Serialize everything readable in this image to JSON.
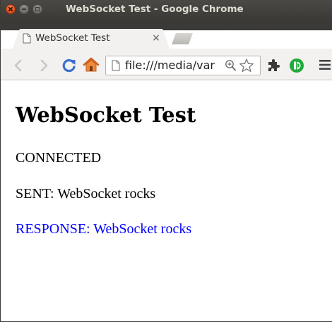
{
  "window": {
    "title": "WebSocket Test - Google Chrome"
  },
  "tab": {
    "title": "WebSocket Test",
    "close_glyph": "×"
  },
  "omnibox": {
    "url": "file:///media/var"
  },
  "page": {
    "heading": "WebSocket Test",
    "messages": [
      {
        "text": "CONNECTED",
        "color": "#000000"
      },
      {
        "text": "SENT: WebSocket rocks",
        "color": "#000000"
      },
      {
        "text": "RESPONSE: WebSocket rocks",
        "color": "#0000ff"
      }
    ]
  },
  "colors": {
    "titlebar": "#3c3b37",
    "close_button": "#e95420",
    "toolbar": "#f2f1f0",
    "reload": "#3b6fd0",
    "home": "#e0793a",
    "extension_green": "#1faa3a",
    "response_text": "#0000ff"
  },
  "icons": [
    "back-icon",
    "forward-icon",
    "reload-icon",
    "home-icon",
    "page-icon",
    "zoom-icon",
    "star-icon",
    "extension-icon",
    "green-extension-icon",
    "menu-icon"
  ]
}
